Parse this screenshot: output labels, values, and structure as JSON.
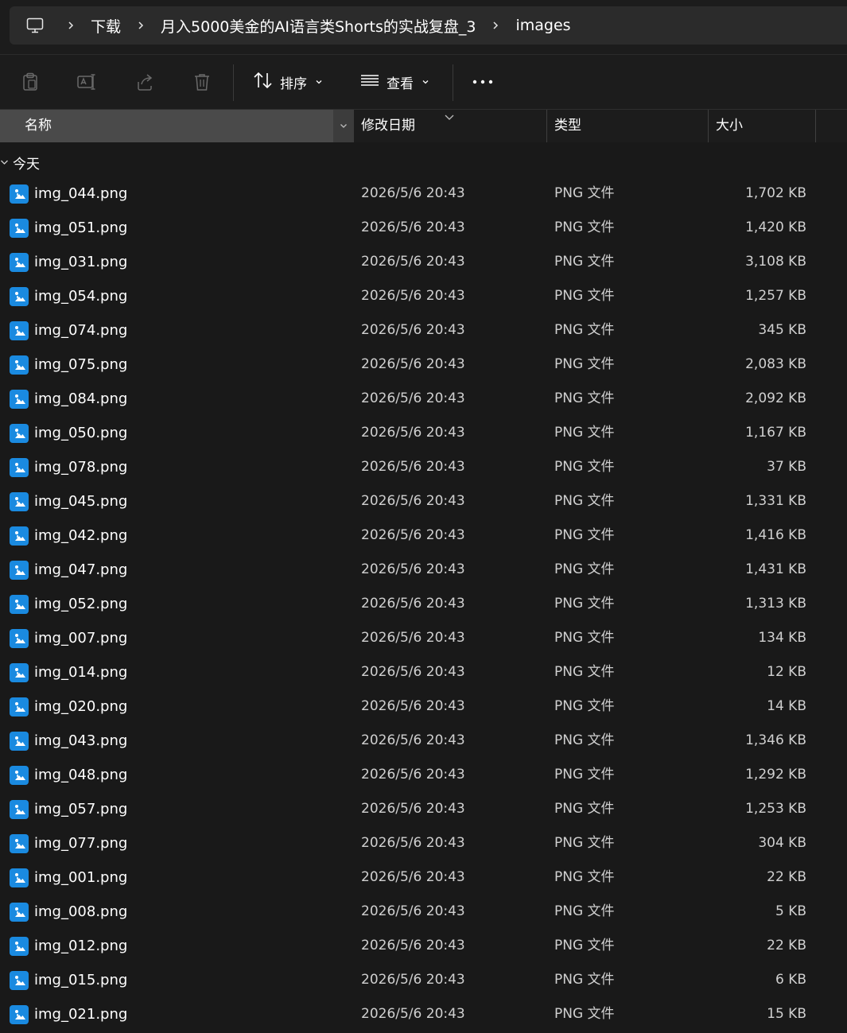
{
  "breadcrumb": {
    "items": [
      {
        "label": "下载"
      },
      {
        "label": "月入5000美金的AI语言类Shorts的实战复盘_3"
      },
      {
        "label": "images"
      }
    ]
  },
  "toolbar": {
    "sort_label": "排序",
    "view_label": "查看"
  },
  "columns": {
    "name": "名称",
    "date": "修改日期",
    "type": "类型",
    "size": "大小"
  },
  "group": {
    "label": "今天"
  },
  "colors": {
    "accent": "#1a8ae0",
    "background": "#191919",
    "header_selected": "#4a4a4a"
  },
  "files": [
    {
      "name": "img_044.png",
      "date": "2026/5/6 20:43",
      "type": "PNG 文件",
      "size": "1,702 KB"
    },
    {
      "name": "img_051.png",
      "date": "2026/5/6 20:43",
      "type": "PNG 文件",
      "size": "1,420 KB"
    },
    {
      "name": "img_031.png",
      "date": "2026/5/6 20:43",
      "type": "PNG 文件",
      "size": "3,108 KB"
    },
    {
      "name": "img_054.png",
      "date": "2026/5/6 20:43",
      "type": "PNG 文件",
      "size": "1,257 KB"
    },
    {
      "name": "img_074.png",
      "date": "2026/5/6 20:43",
      "type": "PNG 文件",
      "size": "345 KB"
    },
    {
      "name": "img_075.png",
      "date": "2026/5/6 20:43",
      "type": "PNG 文件",
      "size": "2,083 KB"
    },
    {
      "name": "img_084.png",
      "date": "2026/5/6 20:43",
      "type": "PNG 文件",
      "size": "2,092 KB"
    },
    {
      "name": "img_050.png",
      "date": "2026/5/6 20:43",
      "type": "PNG 文件",
      "size": "1,167 KB"
    },
    {
      "name": "img_078.png",
      "date": "2026/5/6 20:43",
      "type": "PNG 文件",
      "size": "37 KB"
    },
    {
      "name": "img_045.png",
      "date": "2026/5/6 20:43",
      "type": "PNG 文件",
      "size": "1,331 KB"
    },
    {
      "name": "img_042.png",
      "date": "2026/5/6 20:43",
      "type": "PNG 文件",
      "size": "1,416 KB"
    },
    {
      "name": "img_047.png",
      "date": "2026/5/6 20:43",
      "type": "PNG 文件",
      "size": "1,431 KB"
    },
    {
      "name": "img_052.png",
      "date": "2026/5/6 20:43",
      "type": "PNG 文件",
      "size": "1,313 KB"
    },
    {
      "name": "img_007.png",
      "date": "2026/5/6 20:43",
      "type": "PNG 文件",
      "size": "134 KB"
    },
    {
      "name": "img_014.png",
      "date": "2026/5/6 20:43",
      "type": "PNG 文件",
      "size": "12 KB"
    },
    {
      "name": "img_020.png",
      "date": "2026/5/6 20:43",
      "type": "PNG 文件",
      "size": "14 KB"
    },
    {
      "name": "img_043.png",
      "date": "2026/5/6 20:43",
      "type": "PNG 文件",
      "size": "1,346 KB"
    },
    {
      "name": "img_048.png",
      "date": "2026/5/6 20:43",
      "type": "PNG 文件",
      "size": "1,292 KB"
    },
    {
      "name": "img_057.png",
      "date": "2026/5/6 20:43",
      "type": "PNG 文件",
      "size": "1,253 KB"
    },
    {
      "name": "img_077.png",
      "date": "2026/5/6 20:43",
      "type": "PNG 文件",
      "size": "304 KB"
    },
    {
      "name": "img_001.png",
      "date": "2026/5/6 20:43",
      "type": "PNG 文件",
      "size": "22 KB"
    },
    {
      "name": "img_008.png",
      "date": "2026/5/6 20:43",
      "type": "PNG 文件",
      "size": "5 KB"
    },
    {
      "name": "img_012.png",
      "date": "2026/5/6 20:43",
      "type": "PNG 文件",
      "size": "22 KB"
    },
    {
      "name": "img_015.png",
      "date": "2026/5/6 20:43",
      "type": "PNG 文件",
      "size": "6 KB"
    },
    {
      "name": "img_021.png",
      "date": "2026/5/6 20:43",
      "type": "PNG 文件",
      "size": "15 KB"
    }
  ]
}
